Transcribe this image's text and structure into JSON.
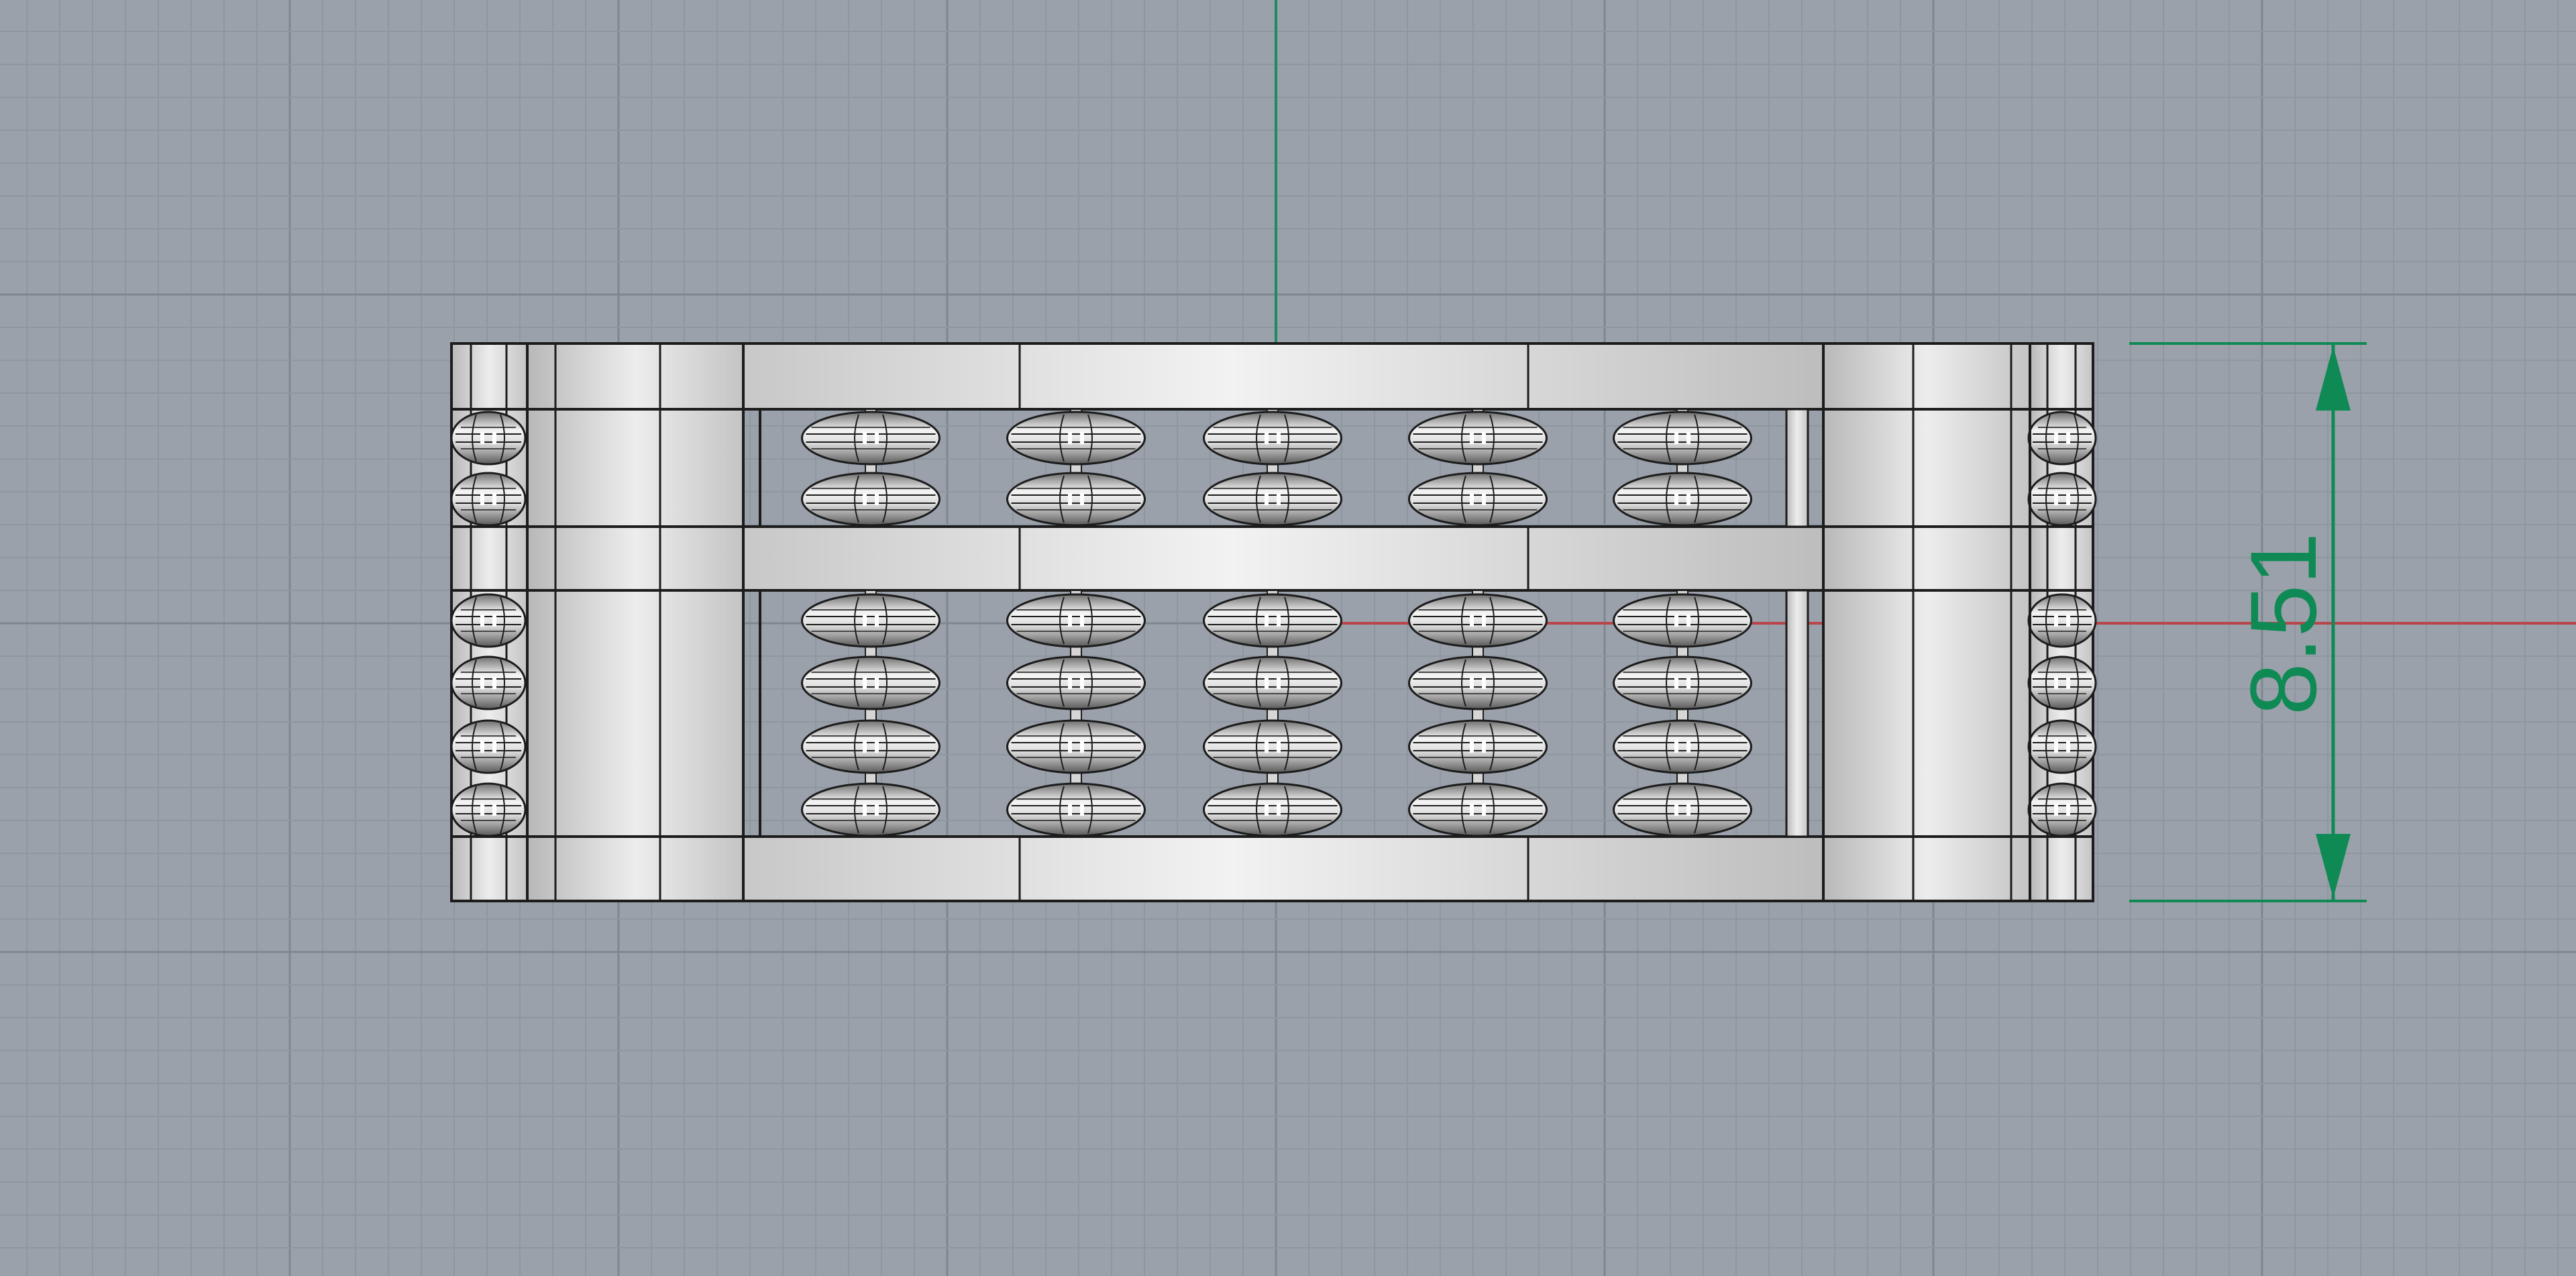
{
  "viewport": {
    "view": "Front",
    "background_color": "#9aa1ab",
    "grid_minor_color": "#8e96a0",
    "grid_major_color": "#7e8690",
    "x_axis_color": "#b8454a",
    "y_axis_color": "#1e8a63"
  },
  "model": {
    "object": "abacus-ring",
    "frame_color": "#e4e4e4",
    "outline_color": "#1c1c1c",
    "columns_visible": 5,
    "upper_beads_per_column": 2,
    "lower_beads_per_column": 4
  },
  "dimension": {
    "value": "8.51",
    "color": "#0f8a55"
  }
}
